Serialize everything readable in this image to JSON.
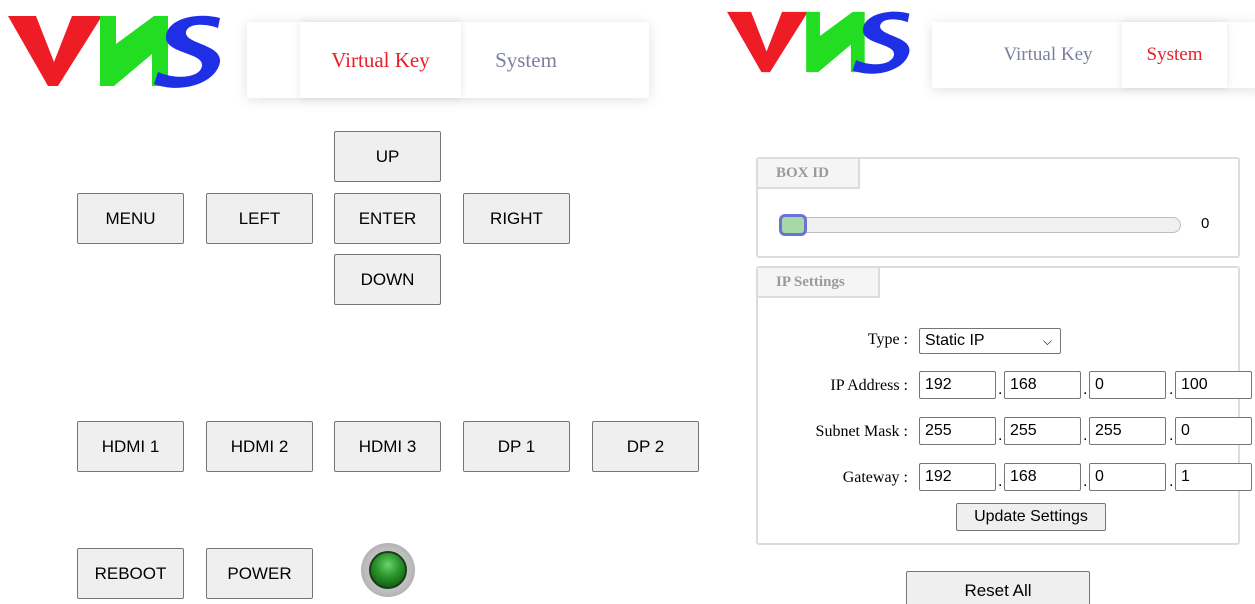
{
  "left": {
    "logo": {
      "text": "VNS",
      "colors": {
        "v": "#ee1c24",
        "n": "#22dd22",
        "s": "#1e2fe6"
      }
    },
    "nav": {
      "tabs": [
        {
          "label": "Virtual Key",
          "active": true
        },
        {
          "label": "System",
          "active": false
        }
      ]
    },
    "buttons": {
      "up": "UP",
      "menu": "MENU",
      "left": "LEFT",
      "enter": "ENTER",
      "right": "RIGHT",
      "down": "DOWN",
      "hdmi1": "HDMI 1",
      "hdmi2": "HDMI 2",
      "hdmi3": "HDMI 3",
      "dp1": "DP 1",
      "dp2": "DP 2",
      "reboot": "REBOOT",
      "power": "POWER"
    },
    "led": {
      "icon": "power-led-icon",
      "color": "#2e9a2e"
    }
  },
  "right": {
    "logo": {
      "text": "VNS"
    },
    "nav": {
      "tabs": [
        {
          "label": "Virtual Key",
          "active": false
        },
        {
          "label": "System",
          "active": true
        }
      ]
    },
    "box_id": {
      "legend": "BOX ID",
      "value": "0"
    },
    "ip_settings": {
      "legend": "IP Settings",
      "type_label": "Type :",
      "type_value": "Static IP",
      "ip_label": "IP Address :",
      "ip": [
        "192",
        "168",
        "0",
        "100"
      ],
      "mask_label": "Subnet Mask :",
      "mask": [
        "255",
        "255",
        "255",
        "0"
      ],
      "gateway_label": "Gateway :",
      "gateway": [
        "192",
        "168",
        "0",
        "1"
      ],
      "update_label": "Update Settings"
    },
    "reset_label": "Reset All"
  }
}
